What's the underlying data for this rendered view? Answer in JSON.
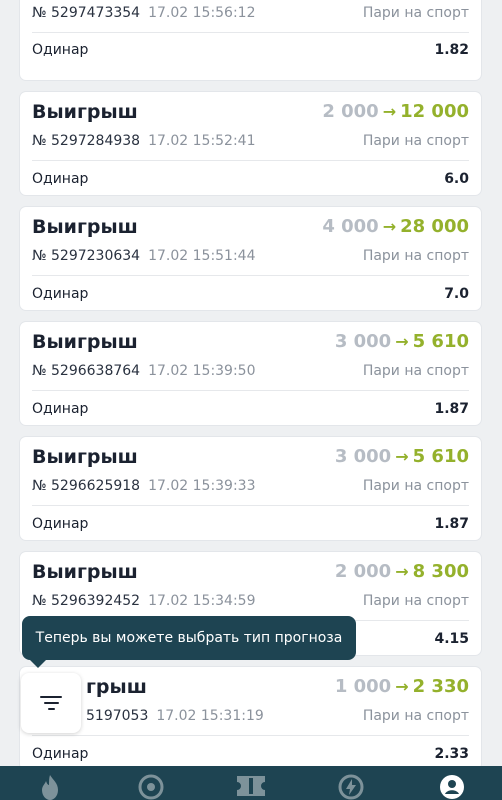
{
  "bets": [
    {
      "status": "",
      "from": "",
      "to": "",
      "number": "№ 5297473354",
      "time": "17.02 15:56:12",
      "type": "Пари на спорт",
      "bet_type": "Одинар",
      "coef": "1.82"
    },
    {
      "status": "Выигрыш",
      "from": "2 000",
      "to": "12 000",
      "number": "№ 5297284938",
      "time": "17.02 15:52:41",
      "type": "Пари на спорт",
      "bet_type": "Одинар",
      "coef": "6.0"
    },
    {
      "status": "Выигрыш",
      "from": "4 000",
      "to": "28 000",
      "number": "№ 5297230634",
      "time": "17.02 15:51:44",
      "type": "Пари на спорт",
      "bet_type": "Одинар",
      "coef": "7.0"
    },
    {
      "status": "Выигрыш",
      "from": "3 000",
      "to": "5 610",
      "number": "№ 5296638764",
      "time": "17.02 15:39:50",
      "type": "Пари на спорт",
      "bet_type": "Одинар",
      "coef": "1.87"
    },
    {
      "status": "Выигрыш",
      "from": "3 000",
      "to": "5 610",
      "number": "№ 5296625918",
      "time": "17.02 15:39:33",
      "type": "Пари на спорт",
      "bet_type": "Одинар",
      "coef": "1.87"
    },
    {
      "status": "Выигрыш",
      "from": "2 000",
      "to": "8 300",
      "number": "№ 5296392452",
      "time": "17.02 15:34:59",
      "type": "Пари на спорт",
      "bet_type": "",
      "coef": "4.15"
    },
    {
      "status": "грыш",
      "from": "1 000",
      "to": "2 330",
      "number": "5197053",
      "time": "17.02 15:31:19",
      "type": "Пари на спорт",
      "bet_type": "Одинар",
      "coef": "2.33"
    }
  ],
  "arrow_symbol": "→",
  "tooltip": {
    "text": "Теперь вы можете выбрать тип прогноза"
  },
  "filter_button": {
    "icon": "filter-icon"
  },
  "nav": [
    {
      "icon": "flame-icon"
    },
    {
      "icon": "target-icon"
    },
    {
      "icon": "ticket-icon"
    },
    {
      "icon": "bolt-icon"
    },
    {
      "icon": "profile-icon"
    }
  ],
  "colors": {
    "accent_green": "#94b12c",
    "muted_amount": "#b6bcc4",
    "nav_bg": "#1e4452",
    "tooltip_bg": "#1e4452"
  }
}
